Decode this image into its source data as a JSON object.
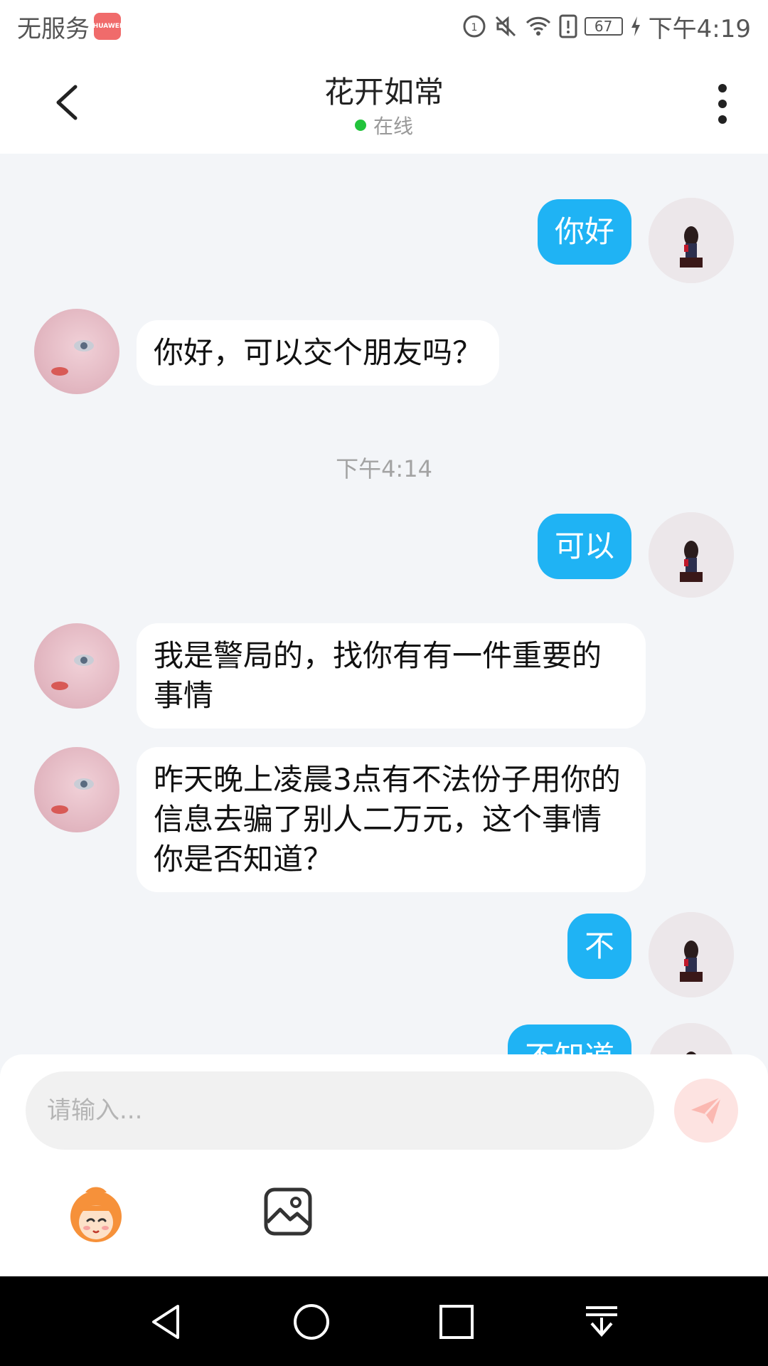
{
  "status_bar": {
    "carrier": "无服务",
    "brand_badge": "HUAWEI",
    "battery": "67",
    "time": "下午4:19"
  },
  "header": {
    "title": "花开如常",
    "status": "在线"
  },
  "chat": {
    "messages": [
      {
        "sender": "self",
        "text": "你好"
      },
      {
        "sender": "other",
        "text": "你好，可以交个朋友吗？"
      },
      {
        "sender": "system",
        "text": "下午4:14"
      },
      {
        "sender": "self",
        "text": "可以"
      },
      {
        "sender": "other",
        "text": "我是警局的，找你有有一件重要的事情"
      },
      {
        "sender": "other",
        "text": "昨天晚上凌晨3点有不法份子用你的信息去骗了别人二万元，这个事情你是否知道？"
      },
      {
        "sender": "self",
        "text": "不"
      },
      {
        "sender": "self",
        "text": "不知道"
      }
    ]
  },
  "input": {
    "placeholder": "请输入..."
  },
  "colors": {
    "self_bubble": "#1fb3f4",
    "background": "#f3f5f8",
    "online_dot": "#22c33b"
  }
}
